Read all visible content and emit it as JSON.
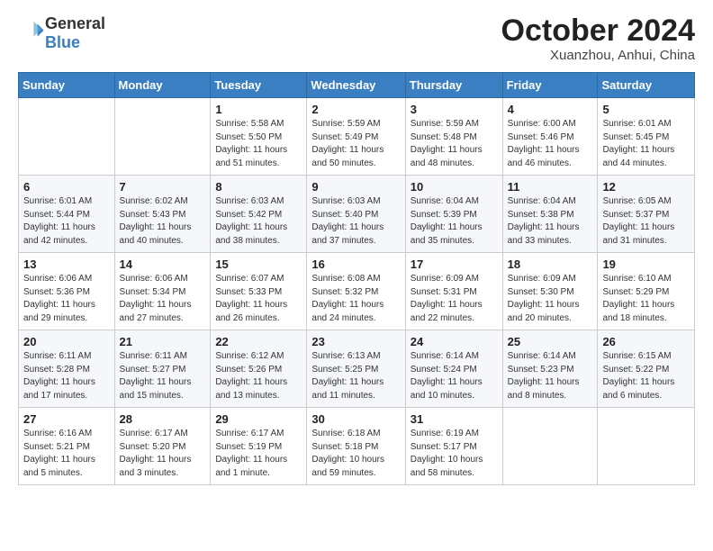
{
  "header": {
    "logo_general": "General",
    "logo_blue": "Blue",
    "month_title": "October 2024",
    "location": "Xuanzhou, Anhui, China"
  },
  "weekdays": [
    "Sunday",
    "Monday",
    "Tuesday",
    "Wednesday",
    "Thursday",
    "Friday",
    "Saturday"
  ],
  "weeks": [
    [
      {
        "day": "",
        "detail": ""
      },
      {
        "day": "",
        "detail": ""
      },
      {
        "day": "1",
        "detail": "Sunrise: 5:58 AM\nSunset: 5:50 PM\nDaylight: 11 hours\nand 51 minutes."
      },
      {
        "day": "2",
        "detail": "Sunrise: 5:59 AM\nSunset: 5:49 PM\nDaylight: 11 hours\nand 50 minutes."
      },
      {
        "day": "3",
        "detail": "Sunrise: 5:59 AM\nSunset: 5:48 PM\nDaylight: 11 hours\nand 48 minutes."
      },
      {
        "day": "4",
        "detail": "Sunrise: 6:00 AM\nSunset: 5:46 PM\nDaylight: 11 hours\nand 46 minutes."
      },
      {
        "day": "5",
        "detail": "Sunrise: 6:01 AM\nSunset: 5:45 PM\nDaylight: 11 hours\nand 44 minutes."
      }
    ],
    [
      {
        "day": "6",
        "detail": "Sunrise: 6:01 AM\nSunset: 5:44 PM\nDaylight: 11 hours\nand 42 minutes."
      },
      {
        "day": "7",
        "detail": "Sunrise: 6:02 AM\nSunset: 5:43 PM\nDaylight: 11 hours\nand 40 minutes."
      },
      {
        "day": "8",
        "detail": "Sunrise: 6:03 AM\nSunset: 5:42 PM\nDaylight: 11 hours\nand 38 minutes."
      },
      {
        "day": "9",
        "detail": "Sunrise: 6:03 AM\nSunset: 5:40 PM\nDaylight: 11 hours\nand 37 minutes."
      },
      {
        "day": "10",
        "detail": "Sunrise: 6:04 AM\nSunset: 5:39 PM\nDaylight: 11 hours\nand 35 minutes."
      },
      {
        "day": "11",
        "detail": "Sunrise: 6:04 AM\nSunset: 5:38 PM\nDaylight: 11 hours\nand 33 minutes."
      },
      {
        "day": "12",
        "detail": "Sunrise: 6:05 AM\nSunset: 5:37 PM\nDaylight: 11 hours\nand 31 minutes."
      }
    ],
    [
      {
        "day": "13",
        "detail": "Sunrise: 6:06 AM\nSunset: 5:36 PM\nDaylight: 11 hours\nand 29 minutes."
      },
      {
        "day": "14",
        "detail": "Sunrise: 6:06 AM\nSunset: 5:34 PM\nDaylight: 11 hours\nand 27 minutes."
      },
      {
        "day": "15",
        "detail": "Sunrise: 6:07 AM\nSunset: 5:33 PM\nDaylight: 11 hours\nand 26 minutes."
      },
      {
        "day": "16",
        "detail": "Sunrise: 6:08 AM\nSunset: 5:32 PM\nDaylight: 11 hours\nand 24 minutes."
      },
      {
        "day": "17",
        "detail": "Sunrise: 6:09 AM\nSunset: 5:31 PM\nDaylight: 11 hours\nand 22 minutes."
      },
      {
        "day": "18",
        "detail": "Sunrise: 6:09 AM\nSunset: 5:30 PM\nDaylight: 11 hours\nand 20 minutes."
      },
      {
        "day": "19",
        "detail": "Sunrise: 6:10 AM\nSunset: 5:29 PM\nDaylight: 11 hours\nand 18 minutes."
      }
    ],
    [
      {
        "day": "20",
        "detail": "Sunrise: 6:11 AM\nSunset: 5:28 PM\nDaylight: 11 hours\nand 17 minutes."
      },
      {
        "day": "21",
        "detail": "Sunrise: 6:11 AM\nSunset: 5:27 PM\nDaylight: 11 hours\nand 15 minutes."
      },
      {
        "day": "22",
        "detail": "Sunrise: 6:12 AM\nSunset: 5:26 PM\nDaylight: 11 hours\nand 13 minutes."
      },
      {
        "day": "23",
        "detail": "Sunrise: 6:13 AM\nSunset: 5:25 PM\nDaylight: 11 hours\nand 11 minutes."
      },
      {
        "day": "24",
        "detail": "Sunrise: 6:14 AM\nSunset: 5:24 PM\nDaylight: 11 hours\nand 10 minutes."
      },
      {
        "day": "25",
        "detail": "Sunrise: 6:14 AM\nSunset: 5:23 PM\nDaylight: 11 hours\nand 8 minutes."
      },
      {
        "day": "26",
        "detail": "Sunrise: 6:15 AM\nSunset: 5:22 PM\nDaylight: 11 hours\nand 6 minutes."
      }
    ],
    [
      {
        "day": "27",
        "detail": "Sunrise: 6:16 AM\nSunset: 5:21 PM\nDaylight: 11 hours\nand 5 minutes."
      },
      {
        "day": "28",
        "detail": "Sunrise: 6:17 AM\nSunset: 5:20 PM\nDaylight: 11 hours\nand 3 minutes."
      },
      {
        "day": "29",
        "detail": "Sunrise: 6:17 AM\nSunset: 5:19 PM\nDaylight: 11 hours\nand 1 minute."
      },
      {
        "day": "30",
        "detail": "Sunrise: 6:18 AM\nSunset: 5:18 PM\nDaylight: 10 hours\nand 59 minutes."
      },
      {
        "day": "31",
        "detail": "Sunrise: 6:19 AM\nSunset: 5:17 PM\nDaylight: 10 hours\nand 58 minutes."
      },
      {
        "day": "",
        "detail": ""
      },
      {
        "day": "",
        "detail": ""
      }
    ]
  ]
}
